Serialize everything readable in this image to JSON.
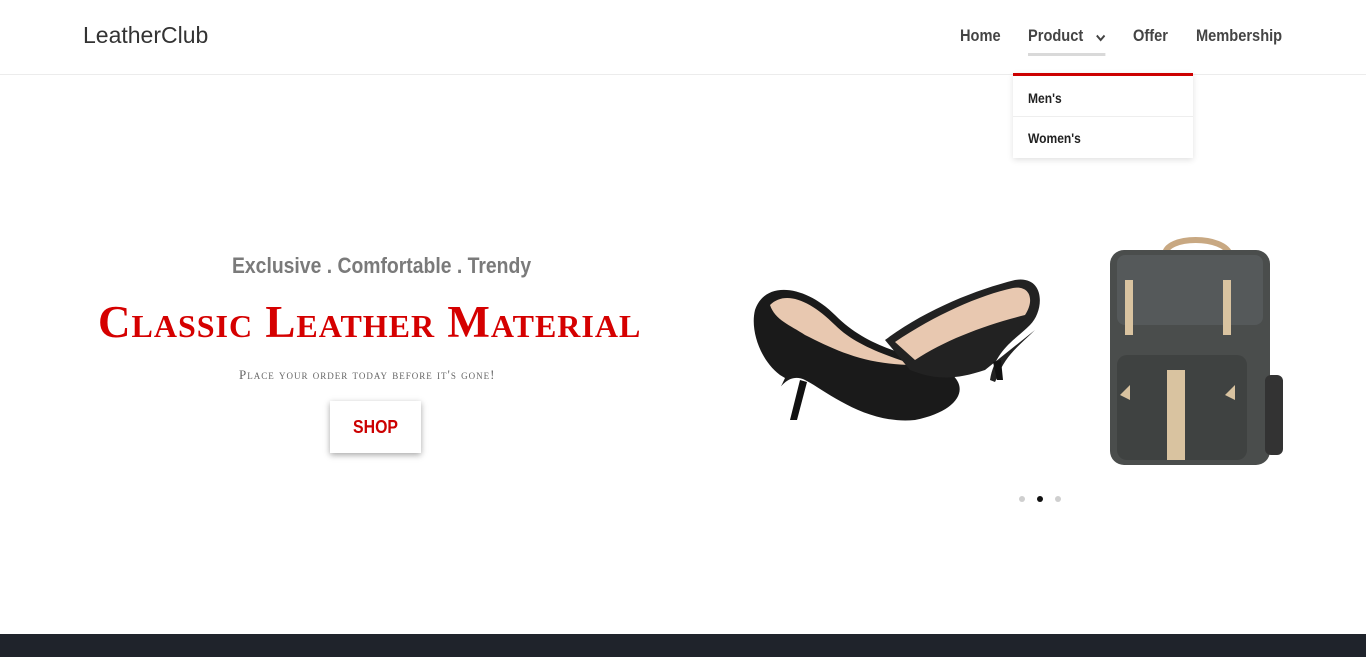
{
  "brand": "LeatherClub",
  "nav": {
    "home": "Home",
    "product": "Product",
    "offer": "Offer",
    "membership": "Membership"
  },
  "dropdown": {
    "mens": "Men's",
    "womens": "Women's"
  },
  "hero": {
    "tagline": "Exclusive . Comfortable . Trendy",
    "headline": "Classic Leather Material",
    "subline": "Place your order today before it's gone!",
    "shop": "SHOP"
  },
  "carousel": {
    "slide_count": 3,
    "active_index": 1
  },
  "colors": {
    "accent": "#cc0000",
    "dark_band": "#1f232b"
  }
}
